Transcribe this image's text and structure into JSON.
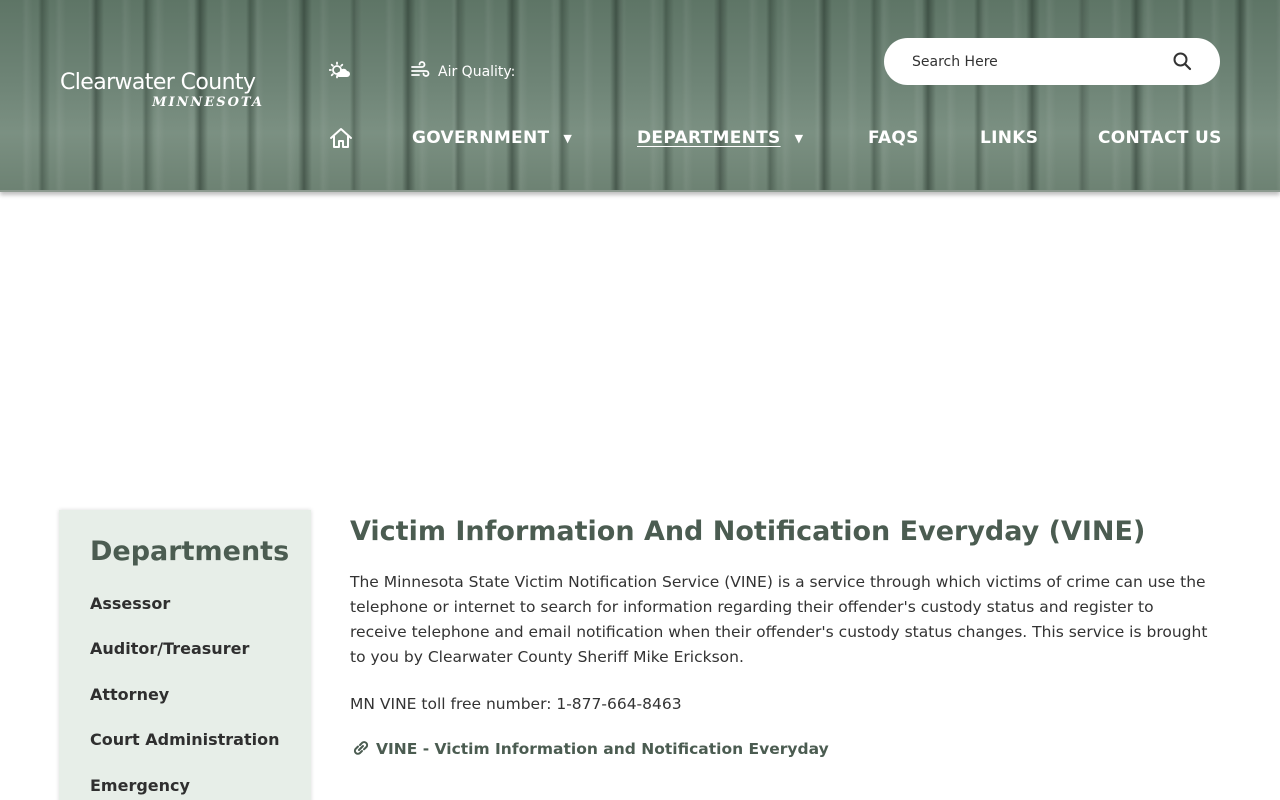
{
  "header": {
    "logo": {
      "name": "Clearwater County",
      "subtitle": "MINNESOTA"
    },
    "weather_icon": "weather-icon",
    "air_quality_label": "Air Quality:",
    "search": {
      "placeholder": "Search Here"
    }
  },
  "nav": {
    "items": [
      {
        "label": "GOVERNMENT",
        "has_dropdown": true
      },
      {
        "label": "DEPARTMENTS",
        "has_dropdown": true,
        "active": true
      },
      {
        "label": "FAQS"
      },
      {
        "label": "LINKS"
      },
      {
        "label": "CONTACT US"
      }
    ]
  },
  "sidebar": {
    "title": "Departments",
    "items": [
      {
        "label": "Assessor"
      },
      {
        "label": "Auditor/Treasurer"
      },
      {
        "label": "Attorney"
      },
      {
        "label": "Court Administration"
      },
      {
        "label": "Emergency"
      }
    ]
  },
  "main": {
    "title": "Victim Information And Notification Everyday (VINE)",
    "intro": "The Minnesota State Victim Notification Service (VINE) is a service through which victims of crime can use the telephone or internet to search for information regarding their offender's custody status and register to receive telephone and email notification when their offender's custody status changes. This service is brought to you by Clearwater County Sheriff Mike Erickson.",
    "phone_text": "MN VINE toll free number: 1-877-664-8463",
    "link_label": "VINE - Victim Information and Notification Everyday"
  },
  "colors": {
    "heading": "#4b5c51",
    "sidebar_bg": "#e7eee8",
    "header_bg": "#6f8577"
  }
}
